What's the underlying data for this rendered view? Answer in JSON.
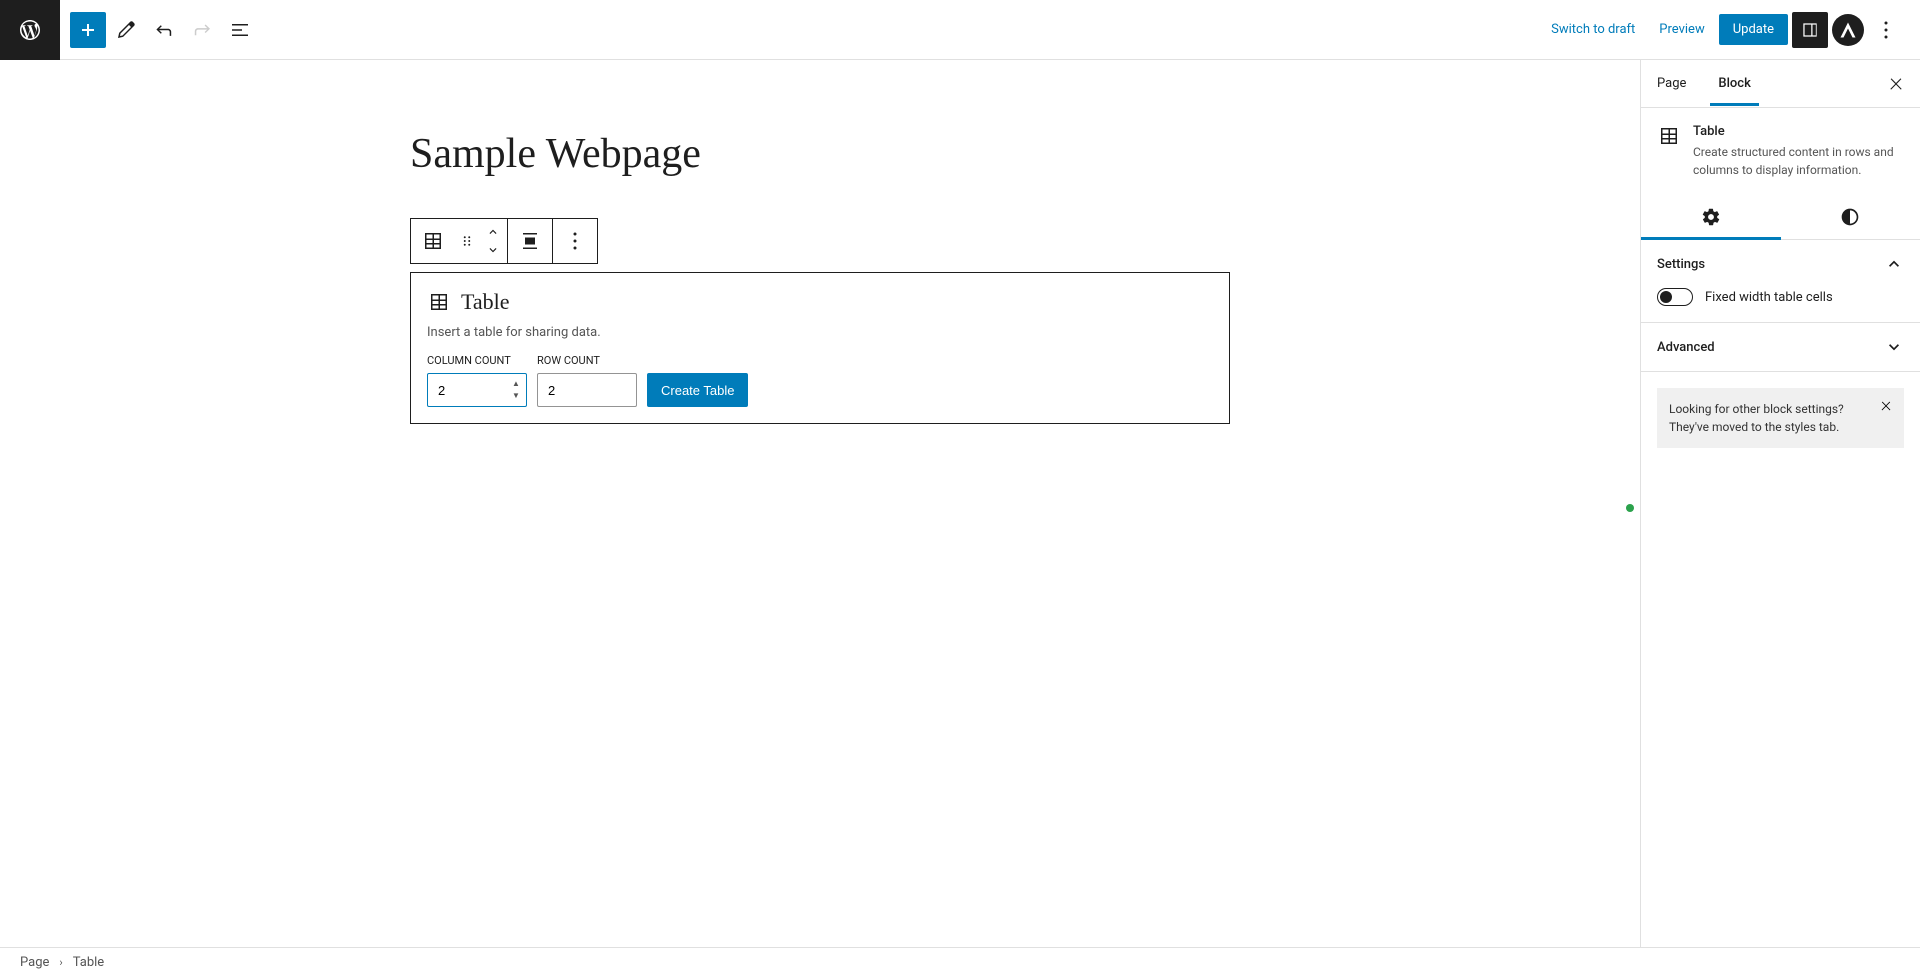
{
  "header": {
    "switch_to_draft": "Switch to draft",
    "preview": "Preview",
    "update": "Update"
  },
  "editor": {
    "page_title": "Sample Webpage",
    "block": {
      "name": "Table",
      "placeholder_desc": "Insert a table for sharing data.",
      "column_label": "COLUMN COUNT",
      "column_value": "2",
      "row_label": "ROW COUNT",
      "row_value": "2",
      "create_label": "Create Table"
    }
  },
  "sidebar": {
    "tab_page": "Page",
    "tab_block": "Block",
    "block_name": "Table",
    "block_desc": "Create structured content in rows and columns to display information.",
    "section_settings": "Settings",
    "toggle_fixed": "Fixed width table cells",
    "section_advanced": "Advanced",
    "notice": "Looking for other block settings? They've moved to the styles tab."
  },
  "breadcrumb": {
    "page": "Page",
    "current": "Table"
  }
}
